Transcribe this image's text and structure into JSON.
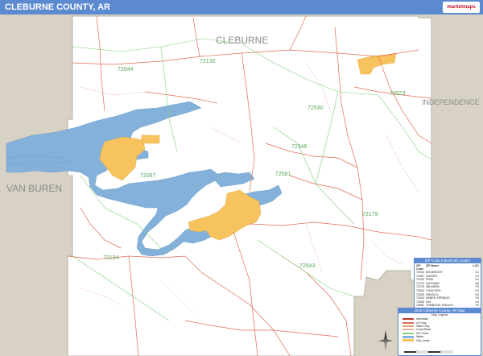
{
  "title": "CLEBURNE COUNTY, AR",
  "logo_text": "marketmaps",
  "county_labels": {
    "center": "CLEBURNE",
    "west": "VAN BUREN",
    "east": "INDEPENDENCE"
  },
  "zip_labels": [
    "72044",
    "72130",
    "72530",
    "72523",
    "72546",
    "72067",
    "72581",
    "72179",
    "72543",
    "72134"
  ],
  "zip_table": {
    "header": "ZIP Code Index/Cell Locator",
    "columns": [
      "ZIP Code",
      "ZIP Name",
      "LOC"
    ],
    "rows": [
      [
        "72044",
        "EDGEMONT",
        "C2"
      ],
      [
        "72067",
        "HIGDEN",
        "C3"
      ],
      [
        "72130",
        "PRIM",
        "E1"
      ],
      [
        "72131",
        "QUITMAN",
        "D6"
      ],
      [
        "72176",
        "WILBURN",
        "F5"
      ],
      [
        "72523",
        "CONCORD",
        "H3"
      ],
      [
        "72530",
        "DRASCO",
        "G2"
      ],
      [
        "72543",
        "HEBER SPRINGS",
        "F6"
      ],
      [
        "72546",
        "IDA",
        "G3"
      ],
      [
        "72581",
        "TUMBLING SHOALS",
        "F4"
      ]
    ]
  },
  "map_key": {
    "header": "2018 Cleburne County, AR Map",
    "subheader": "Map Legend",
    "items": [
      "Interstate",
      "US Hwy",
      "State Hwy",
      "Local Road",
      "ZIP Code",
      "Water",
      "City Limits"
    ]
  },
  "colors": {
    "title_bar": "#5b8ad1",
    "water": "#84b1d9",
    "city": "#f6c35f",
    "land_outside": "#d8d2c4",
    "county_fill": "#ffffff",
    "roads": "#e06b52",
    "zip_lines": "#7fd07a"
  }
}
